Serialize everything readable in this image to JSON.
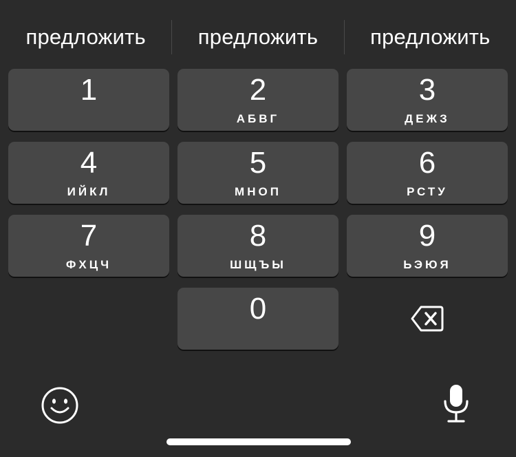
{
  "suggestions": [
    "предложить",
    "предложить",
    "предложить"
  ],
  "keys": [
    {
      "digit": "1",
      "letters": ""
    },
    {
      "digit": "2",
      "letters": "АБВГ"
    },
    {
      "digit": "3",
      "letters": "ДЕЖЗ"
    },
    {
      "digit": "4",
      "letters": "ИЙКЛ"
    },
    {
      "digit": "5",
      "letters": "МНОП"
    },
    {
      "digit": "6",
      "letters": "РСТУ"
    },
    {
      "digit": "7",
      "letters": "ФХЦЧ"
    },
    {
      "digit": "8",
      "letters": "ШЩЪЫ"
    },
    {
      "digit": "9",
      "letters": "ЬЭЮЯ"
    },
    {
      "digit": "0",
      "letters": ""
    }
  ],
  "icons": {
    "delete": "backspace-icon",
    "emoji": "smiley-face-icon",
    "mic": "microphone-icon"
  },
  "colors": {
    "background": "#2b2b2b",
    "key": "#474747",
    "text": "#ffffff"
  }
}
